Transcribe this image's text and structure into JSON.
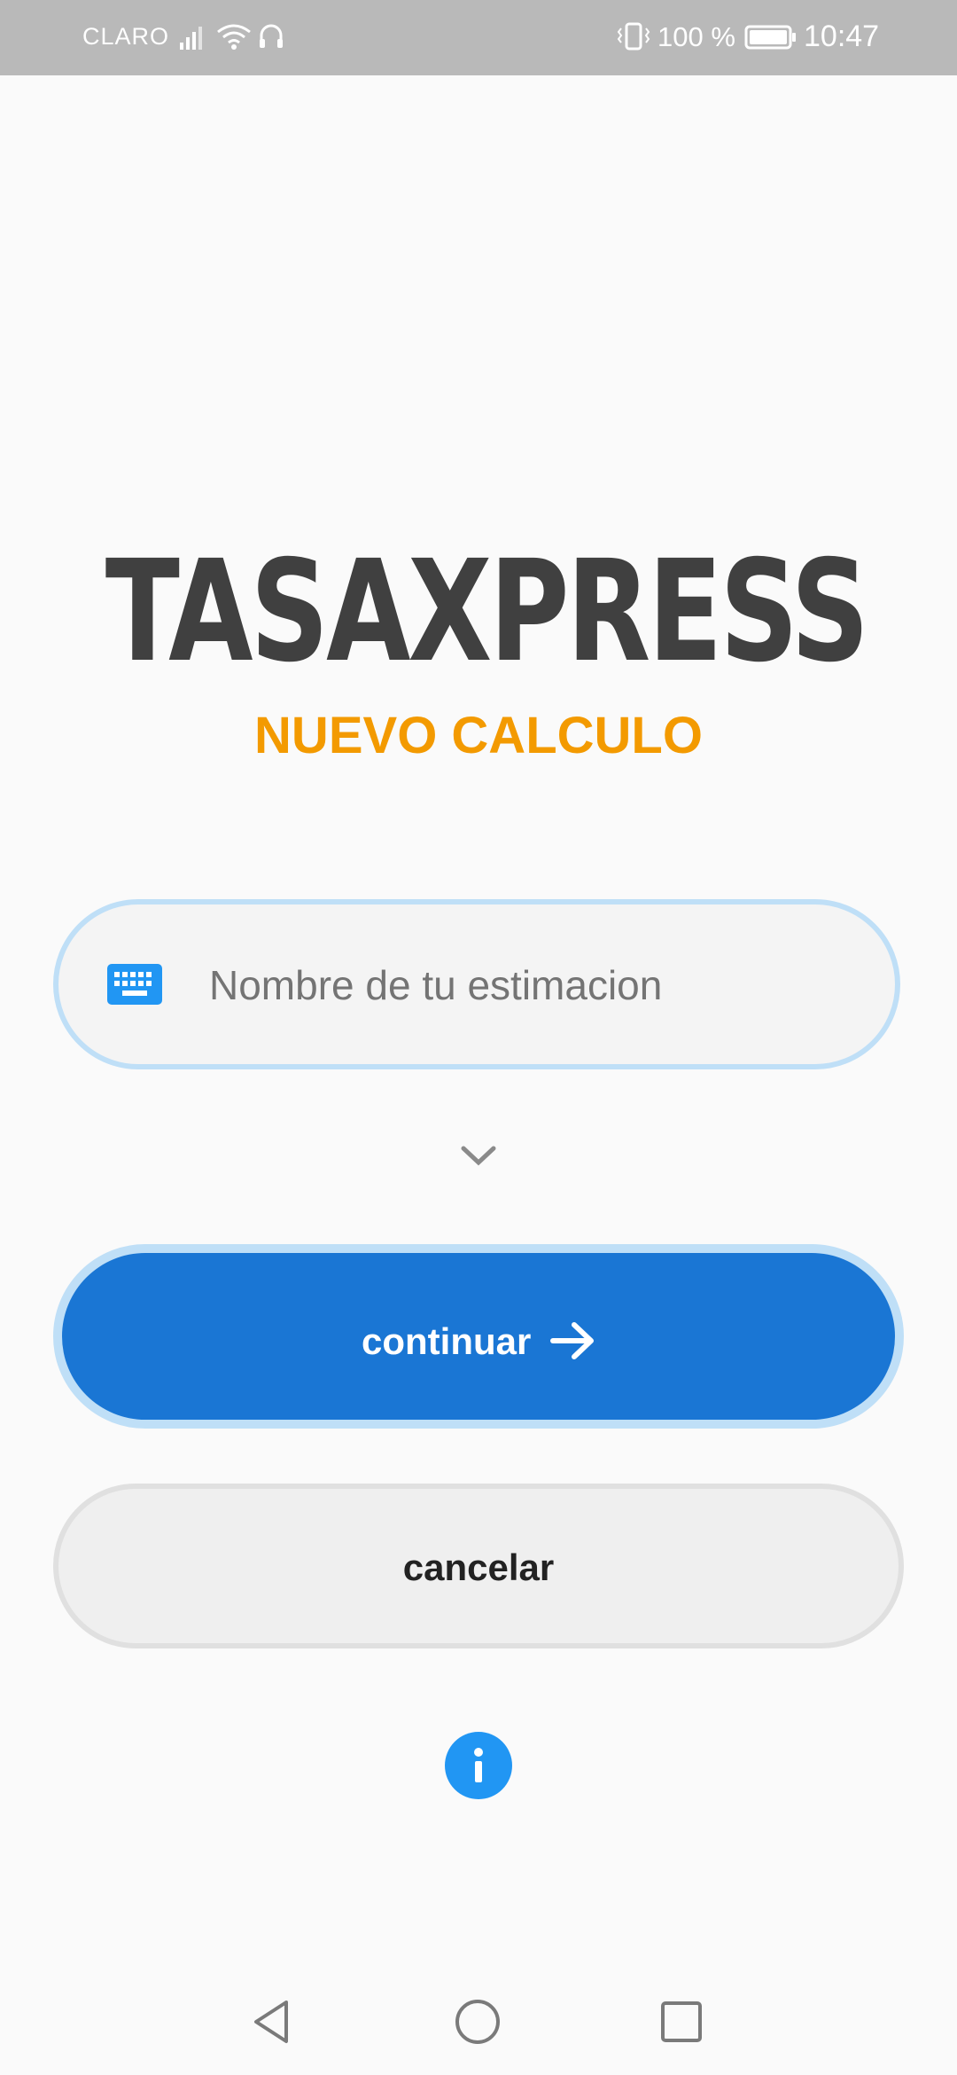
{
  "status_bar": {
    "carrier": "CLARO",
    "battery_percent": "100 %",
    "time": "10:47",
    "icons": [
      "signal-icon",
      "wifi-icon",
      "headset-icon",
      "vibrate-icon",
      "battery-icon"
    ]
  },
  "header": {
    "app_title": "TASAXPRESS",
    "subtitle": "NUEVO CALCULO"
  },
  "form": {
    "name_field": {
      "value": "",
      "placeholder": "Nombre de tu estimacion",
      "icon": "keyboard-icon"
    },
    "expand_icon": "chevron-down-icon"
  },
  "actions": {
    "continue_label": "continuar",
    "continue_icon": "arrow-right-icon",
    "cancel_label": "cancelar",
    "info_icon": "info-icon"
  },
  "nav_bar": {
    "icons": [
      "back-icon",
      "home-icon",
      "recents-icon"
    ]
  },
  "colors": {
    "status_bar": "#b9b9b9",
    "title": "#404040",
    "subtitle": "#f39a00",
    "primary": "#1a76d4",
    "focus_ring": "#bfdff7",
    "info": "#2196f3",
    "background": "#fafafa"
  }
}
